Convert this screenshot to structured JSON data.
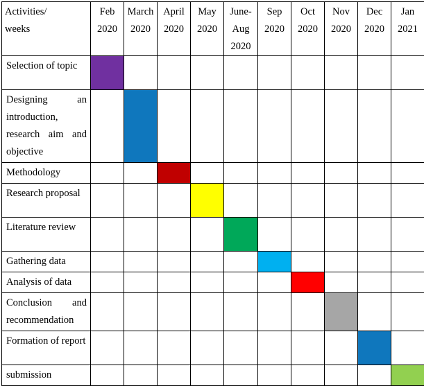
{
  "chart_data": {
    "type": "table",
    "title": "Gantt chart of research activities by month",
    "xlabel": "weeks",
    "ylabel": "Activities",
    "corner_header_lines": [
      "Activities/",
      "weeks"
    ],
    "categories": [
      "Feb 2020",
      "March 2020",
      "April 2020",
      "May 2020",
      "June-Aug 2020",
      "Sep 2020",
      "Oct 2020",
      "Nov 2020",
      "Dec 2020",
      "Jan 2021"
    ],
    "column_headers": [
      {
        "lines": [
          "Feb",
          "2020"
        ]
      },
      {
        "lines": [
          "March",
          "2020"
        ]
      },
      {
        "lines": [
          "April",
          "2020"
        ]
      },
      {
        "lines": [
          "May",
          "2020"
        ]
      },
      {
        "lines": [
          "June-",
          "Aug",
          "2020"
        ]
      },
      {
        "lines": [
          "Sep",
          "2020"
        ]
      },
      {
        "lines": [
          "Oct",
          "2020"
        ]
      },
      {
        "lines": [
          "Nov",
          "2020"
        ]
      },
      {
        "lines": [
          "Dec",
          "2020"
        ]
      },
      {
        "lines": [
          "Jan",
          "2021"
        ]
      }
    ],
    "rows": [
      {
        "activity": "Selection of topic",
        "lines": 2,
        "filled_columns": [
          0
        ],
        "color": "#7030A0",
        "color_name": "purple"
      },
      {
        "activity": "Designing an introduction, research aim and objective",
        "lines": 4,
        "filled_columns": [
          1
        ],
        "color": "#0F77BD",
        "color_name": "blue"
      },
      {
        "activity": "Methodology",
        "lines": 1,
        "filled_columns": [
          2
        ],
        "color": "#C00000",
        "color_name": "dark-red"
      },
      {
        "activity": "Research proposal",
        "lines": 2,
        "filled_columns": [
          3
        ],
        "color": "#FFFF00",
        "color_name": "yellow"
      },
      {
        "activity": "Literature review",
        "lines": 2,
        "filled_columns": [
          4
        ],
        "color": "#00A859",
        "color_name": "green"
      },
      {
        "activity": "Gathering data",
        "lines": 1,
        "filled_columns": [
          5
        ],
        "color": "#00B0F0",
        "color_name": "cyan"
      },
      {
        "activity": "Analysis of data",
        "lines": 1,
        "filled_columns": [
          6
        ],
        "color": "#FF0000",
        "color_name": "red"
      },
      {
        "activity": "Conclusion and recommendation",
        "lines": 2,
        "filled_columns": [
          7
        ],
        "color": "#A6A6A6",
        "color_name": "gray"
      },
      {
        "activity": "Formation of report",
        "lines": 2,
        "filled_columns": [
          8
        ],
        "color": "#0F77BD",
        "color_name": "blue"
      },
      {
        "activity": "submission",
        "lines": 1,
        "filled_columns": [
          9
        ],
        "color": "#92D050",
        "color_name": "light-green"
      }
    ],
    "grid": true,
    "legend": "none"
  }
}
